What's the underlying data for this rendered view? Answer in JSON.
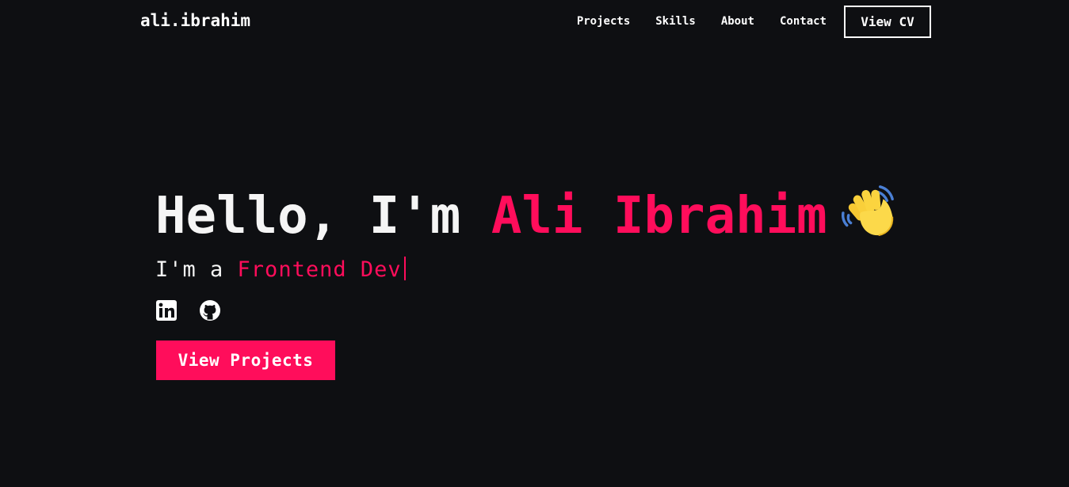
{
  "brand": {
    "name": "ali.ibrahim"
  },
  "nav": {
    "links": [
      "Projects",
      "Skills",
      "About",
      "Contact"
    ],
    "cv_label": "View CV"
  },
  "hero": {
    "greeting": "Hello, I'm ",
    "name": "Ali Ibrahim",
    "wave_icon": "waving-hand-emoji",
    "sub_prefix": "I'm a ",
    "role": "Frontend Dev",
    "socials": [
      {
        "icon": "linkedin-icon"
      },
      {
        "icon": "github-icon"
      }
    ],
    "cta_label": "View Projects"
  },
  "colors": {
    "background": "#0e0f12",
    "accent": "#ff0d5b",
    "text": "#f5f5f5"
  }
}
